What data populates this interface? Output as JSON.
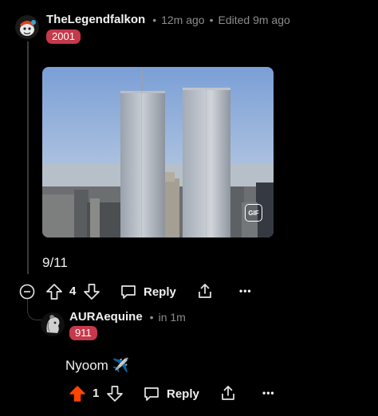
{
  "comment": {
    "username": "TheLegendfalkon",
    "time": "12m ago",
    "edited": "Edited 9m ago",
    "flair": "2001",
    "gif_badge": "GIF",
    "text": "9/11",
    "vote_count": "4",
    "reply_label": "Reply",
    "more_label": "•••"
  },
  "reply": {
    "username": "AURAequine",
    "time": "in 1m",
    "flair": "911",
    "text": "Nyoom ✈️",
    "vote_count": "1",
    "reply_label": "Reply",
    "more_label": "•••",
    "upvote_color": "#ff4500"
  },
  "colors": {
    "background": "#000000",
    "flair_bg": "#c6394a",
    "meta": "#8c8c8c"
  }
}
